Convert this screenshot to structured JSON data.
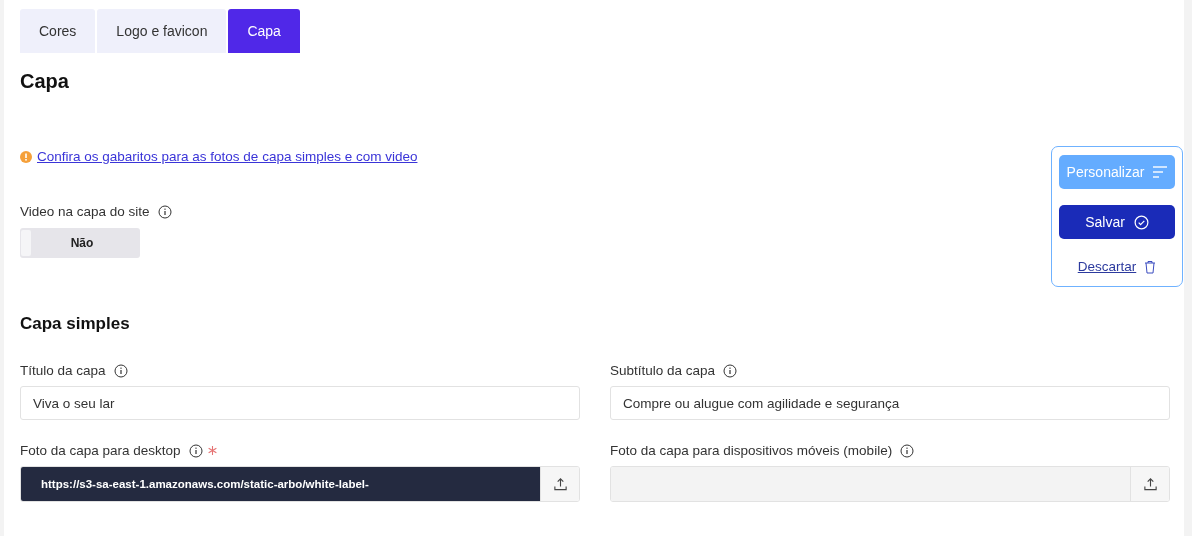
{
  "tabs": [
    {
      "label": "Cores",
      "selected": false
    },
    {
      "label": "Logo e favicon",
      "selected": false
    },
    {
      "label": "Capa",
      "selected": true
    }
  ],
  "page_title": "Capa",
  "notice": {
    "link": "Confira os gabaritos para as fotos de capa simples e com video"
  },
  "video_toggle": {
    "label": "Video na capa do site",
    "on": false,
    "state_text": "Não"
  },
  "actions": {
    "customize": "Personalizar",
    "save": "Salvar",
    "discard": "Descartar"
  },
  "section": {
    "title": "Capa simples",
    "fields": [
      {
        "kind": "text",
        "label": "Título da capa",
        "required": false,
        "value": "Viva o seu lar"
      },
      {
        "kind": "text",
        "label": "Subtítulo da capa",
        "required": false,
        "value": "Compre ou alugue com agilidade e segurança"
      },
      {
        "kind": "upload",
        "label": "Foto da capa para desktop",
        "required": true,
        "value": "https://s3-sa-east-1.amazonaws.com/static-arbo/white-label-"
      },
      {
        "kind": "upload",
        "label": "Foto da capa para dispositivos móveis (mobile)",
        "required": false
      }
    ]
  }
}
